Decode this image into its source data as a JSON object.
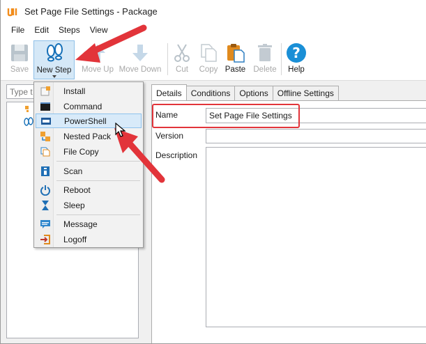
{
  "window": {
    "title": "Set Page File Settings - Package"
  },
  "menubar": [
    "File",
    "Edit",
    "Steps",
    "View"
  ],
  "toolbar": {
    "save": "Save",
    "new_step": "New Step",
    "move_up": "Move Up",
    "move_down": "Move Down",
    "cut": "Cut",
    "copy": "Copy",
    "paste": "Paste",
    "delete": "Delete",
    "help": "Help"
  },
  "search": {
    "placeholder": "Type t"
  },
  "dropdown": {
    "items": [
      {
        "label": "Install",
        "icon": "install-icon"
      },
      {
        "label": "Command",
        "icon": "command-icon"
      },
      {
        "label": "PowerShell",
        "icon": "powershell-icon",
        "hover": true
      },
      {
        "label": "Nested Pack",
        "icon": "nested-package-icon"
      },
      {
        "label": "File Copy",
        "icon": "file-copy-icon"
      },
      {
        "label": "Scan",
        "icon": "scan-icon"
      },
      {
        "label": "Reboot",
        "icon": "reboot-icon"
      },
      {
        "label": "Sleep",
        "icon": "sleep-icon"
      },
      {
        "label": "Message",
        "icon": "message-icon"
      },
      {
        "label": "Logoff",
        "icon": "logoff-icon"
      }
    ]
  },
  "tabs": [
    "Details",
    "Conditions",
    "Options",
    "Offline Settings"
  ],
  "details": {
    "name_label": "Name",
    "name_value": "Set Page File Settings",
    "version_label": "Version",
    "version_value": "",
    "description_label": "Description",
    "description_value": ""
  },
  "colors": {
    "annotation_red": "#e2343a",
    "hover_blue": "#d8eaf9",
    "help_blue": "#1a8fd6"
  }
}
